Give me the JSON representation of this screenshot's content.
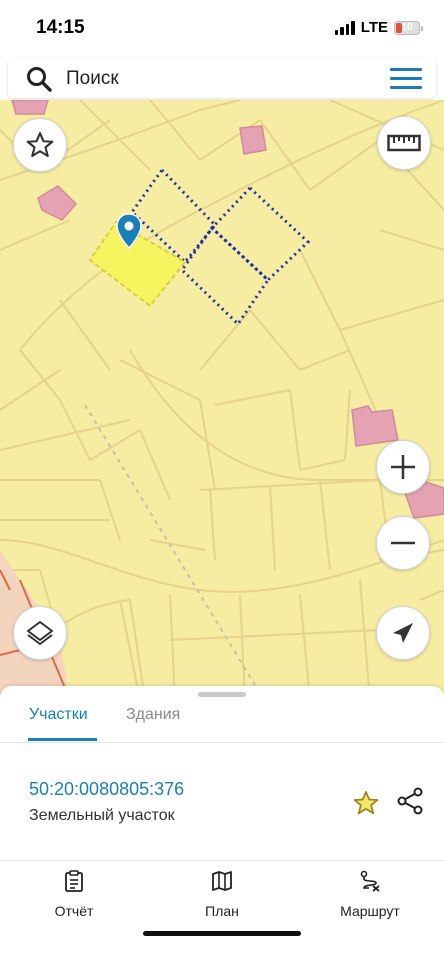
{
  "status_bar": {
    "time": "14:15",
    "network": "LTE",
    "battery": "10"
  },
  "search": {
    "placeholder": "Поиск",
    "icon": "search-icon",
    "menu_icon": "hamburger-menu-icon"
  },
  "map": {
    "buttons": {
      "favorites": "star-icon",
      "ruler": "ruler-icon",
      "zoom_in": "plus-icon",
      "zoom_out": "minus-icon",
      "layers": "layers-icon",
      "locate": "navigation-arrow-icon"
    },
    "colors": {
      "background": "#f6eca2",
      "parcel_line": "#e5d38a",
      "selected_parcel": "#f7f55f",
      "building": "#e4a2b2",
      "dotted_parcels": "#1f2fa8",
      "marker": "#1a7fb9"
    }
  },
  "sheet": {
    "tabs": [
      {
        "label": "Участки",
        "active": true
      },
      {
        "label": "Здания",
        "active": false
      }
    ],
    "result": {
      "cadastral_number": "50:20:0080805:376",
      "type": "Земельный участок"
    }
  },
  "bottom_nav": [
    {
      "label": "Отчёт",
      "icon": "report-icon"
    },
    {
      "label": "План",
      "icon": "map-plan-icon"
    },
    {
      "label": "Маршрут",
      "icon": "route-icon"
    }
  ]
}
